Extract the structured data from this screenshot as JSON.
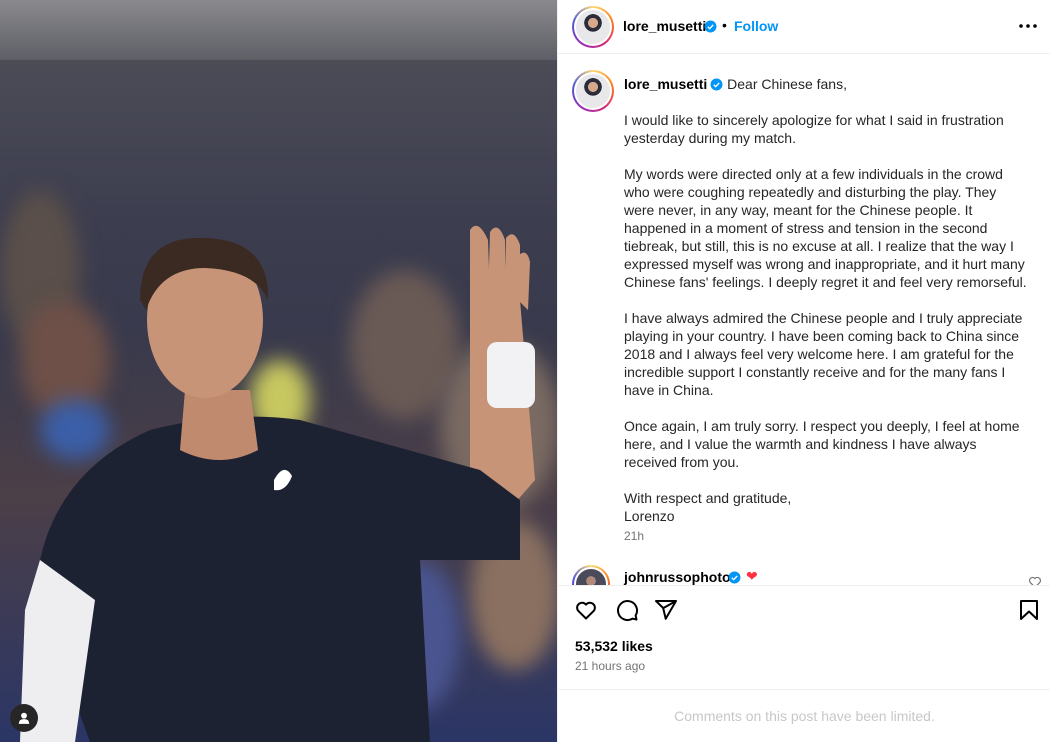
{
  "post": {
    "author": "lore_musetti",
    "follow_separator": "•",
    "follow_label": "Follow",
    "more_icon": "more-horizontal-icon"
  },
  "caption": {
    "author": "lore_musetti",
    "opening": "Dear Chinese fans,",
    "paragraphs": [
      "I would like to sincerely apologize for what I said in frustration yesterday during my match.",
      "My words were directed only at a few individuals in the crowd who were coughing repeatedly and disturbing the play. They were never, in any way, meant for the Chinese people. It happened in a moment of stress and tension in the second tiebreak, but still, this is no excuse at all. I realize that the way I expressed myself was wrong and inappropriate, and it hurt many Chinese fans' feelings. I deeply regret it and feel very remorseful.",
      "I have always admired the Chinese people and I truly appreciate playing in your country. I have been coming back to China since 2018 and I always feel very welcome here. I am grateful for the incredible support I constantly receive and for the many fans I have in China.",
      "Once again, I am truly sorry. I respect you deeply, I feel at home here, and I value the warmth and kindness I have always received from you.",
      "With respect and gratitude,",
      "Lorenzo"
    ],
    "time": "21h"
  },
  "reply": {
    "author": "johnrussophoto",
    "emoji": "❤"
  },
  "engagement": {
    "likes": "53,532 likes",
    "posted": "21 hours ago"
  },
  "footer": {
    "notice": "Comments on this post have been limited."
  },
  "colors": {
    "link_blue": "#0095f6",
    "verified_blue": "#0095f6",
    "muted_gray": "#737373",
    "disabled_gray": "#c7c7c7",
    "heart_pink": "#ff3040"
  }
}
